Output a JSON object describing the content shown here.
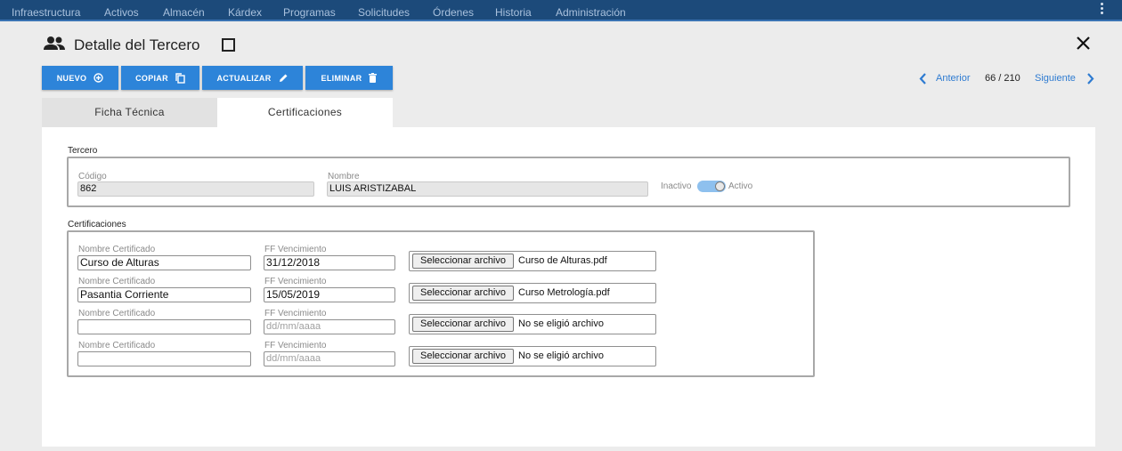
{
  "nav": {
    "items": [
      "Infraestructura",
      "Activos",
      "Almacén",
      "Kárdex",
      "Programas",
      "Solicitudes",
      "Órdenes",
      "Historia",
      "Administración"
    ]
  },
  "header": {
    "title": "Detalle del Tercero"
  },
  "toolbar": {
    "new_label": "NUEVO",
    "copy_label": "COPIAR",
    "update_label": "ACTUALIZAR",
    "delete_label": "ELIMINAR"
  },
  "pager": {
    "prev_label": "Anterior",
    "position": "66 / 210",
    "next_label": "Siguiente"
  },
  "tabs": [
    {
      "label": "Ficha Técnica",
      "active": false
    },
    {
      "label": "Certificaciones",
      "active": true
    }
  ],
  "tercero": {
    "legend": "Tercero",
    "codigo_label": "Código",
    "codigo_value": "862",
    "nombre_label": "Nombre",
    "nombre_value": "LUIS ARISTIZABAL",
    "toggle_off_label": "Inactivo",
    "toggle_on_label": "Activo",
    "active": true
  },
  "certificaciones": {
    "legend": "Certificaciones",
    "rows": [
      {
        "name_label": "Nombre Certificado",
        "name_value": "Curso de Alturas",
        "date_label": "FF Vencimiento",
        "date_value": "31/12/2018",
        "file_button": "Seleccionar archivo",
        "file_name": "Curso de Alturas.pdf"
      },
      {
        "name_label": "Nombre Certificado",
        "name_value": "Pasantia Corriente",
        "date_label": "FF Vencimiento",
        "date_value": "15/05/2019",
        "file_button": "Seleccionar archivo",
        "file_name": "Curso Metrología.pdf"
      },
      {
        "name_label": "Nombre Certificado",
        "name_value": "",
        "date_label": "FF Vencimiento",
        "date_value": "dd/mm/aaaa",
        "file_button": "Seleccionar archivo",
        "file_name": "No se eligió archivo"
      },
      {
        "name_label": "Nombre Certificado",
        "name_value": "",
        "date_label": "FF Vencimiento",
        "date_value": "dd/mm/aaaa",
        "file_button": "Seleccionar archivo",
        "file_name": "No se eligió archivo"
      }
    ]
  },
  "colors": {
    "nav_bg": "#1c4a7a",
    "accent": "#2d84d9",
    "link": "#2e7bd1",
    "toggle": "#8ec0ee"
  }
}
